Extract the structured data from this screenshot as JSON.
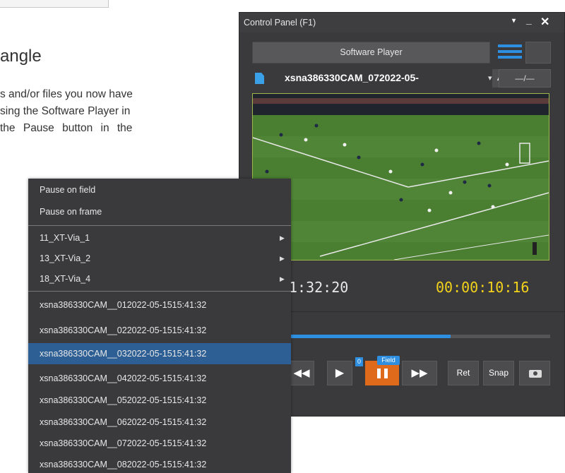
{
  "doc": {
    "heading": "angle",
    "lines": [
      "s and/or files you now have",
      "sing the Software Player in",
      "the Pause button in the"
    ]
  },
  "panel": {
    "title": "Control Panel (F1)",
    "window_buttons": {
      "menu": "▾",
      "minimize": "_",
      "close": "✕"
    },
    "player_button": "Software Player",
    "clip_name": "xsna386330CAM_072022-05-",
    "clip_icon": "file-icon",
    "eject_glyph": "▲",
    "io_button": "—/—",
    "timecode_left": "1:32:20",
    "timecode_right": "00:00:10:16",
    "progress": 0.68,
    "controls": {
      "rewind": "◀◀",
      "play": "▶",
      "play_badge": "0",
      "pause_badge": "Field",
      "fast_forward": "▶▶",
      "ret": "Ret",
      "snap": "Snap",
      "camera_icon": "camera-icon"
    },
    "colors": {
      "accent": "#2e8fe0",
      "pause": "#e06a1c",
      "timecode": "#f2d21a",
      "video_border": "#9cb84a"
    }
  },
  "menu": {
    "mode_items": [
      {
        "label": "Pause on field",
        "checked": true
      },
      {
        "label": "Pause on frame",
        "checked": false
      }
    ],
    "submenu_items": [
      {
        "label": "11_XT-Via_1"
      },
      {
        "label": "13_XT-Via_2"
      },
      {
        "label": "18_XT-Via_4"
      }
    ],
    "clip_items": [
      {
        "label": "xsna386330CAM__012022-05-1515:41:32"
      },
      {
        "label": "xsna386330CAM__022022-05-1515:41:32"
      },
      {
        "label": "xsna386330CAM__032022-05-1515:41:32",
        "selected": true
      },
      {
        "label": "xsna386330CAM__042022-05-1515:41:32"
      },
      {
        "label": "xsna386330CAM__052022-05-1515:41:32"
      },
      {
        "label": "xsna386330CAM__062022-05-1515:41:32"
      },
      {
        "label": "xsna386330CAM__072022-05-1515:41:32"
      },
      {
        "label": "xsna386330CAM__082022-05-1515:41:32"
      }
    ],
    "check_glyph": "✓",
    "arrow_glyph": "▶"
  }
}
